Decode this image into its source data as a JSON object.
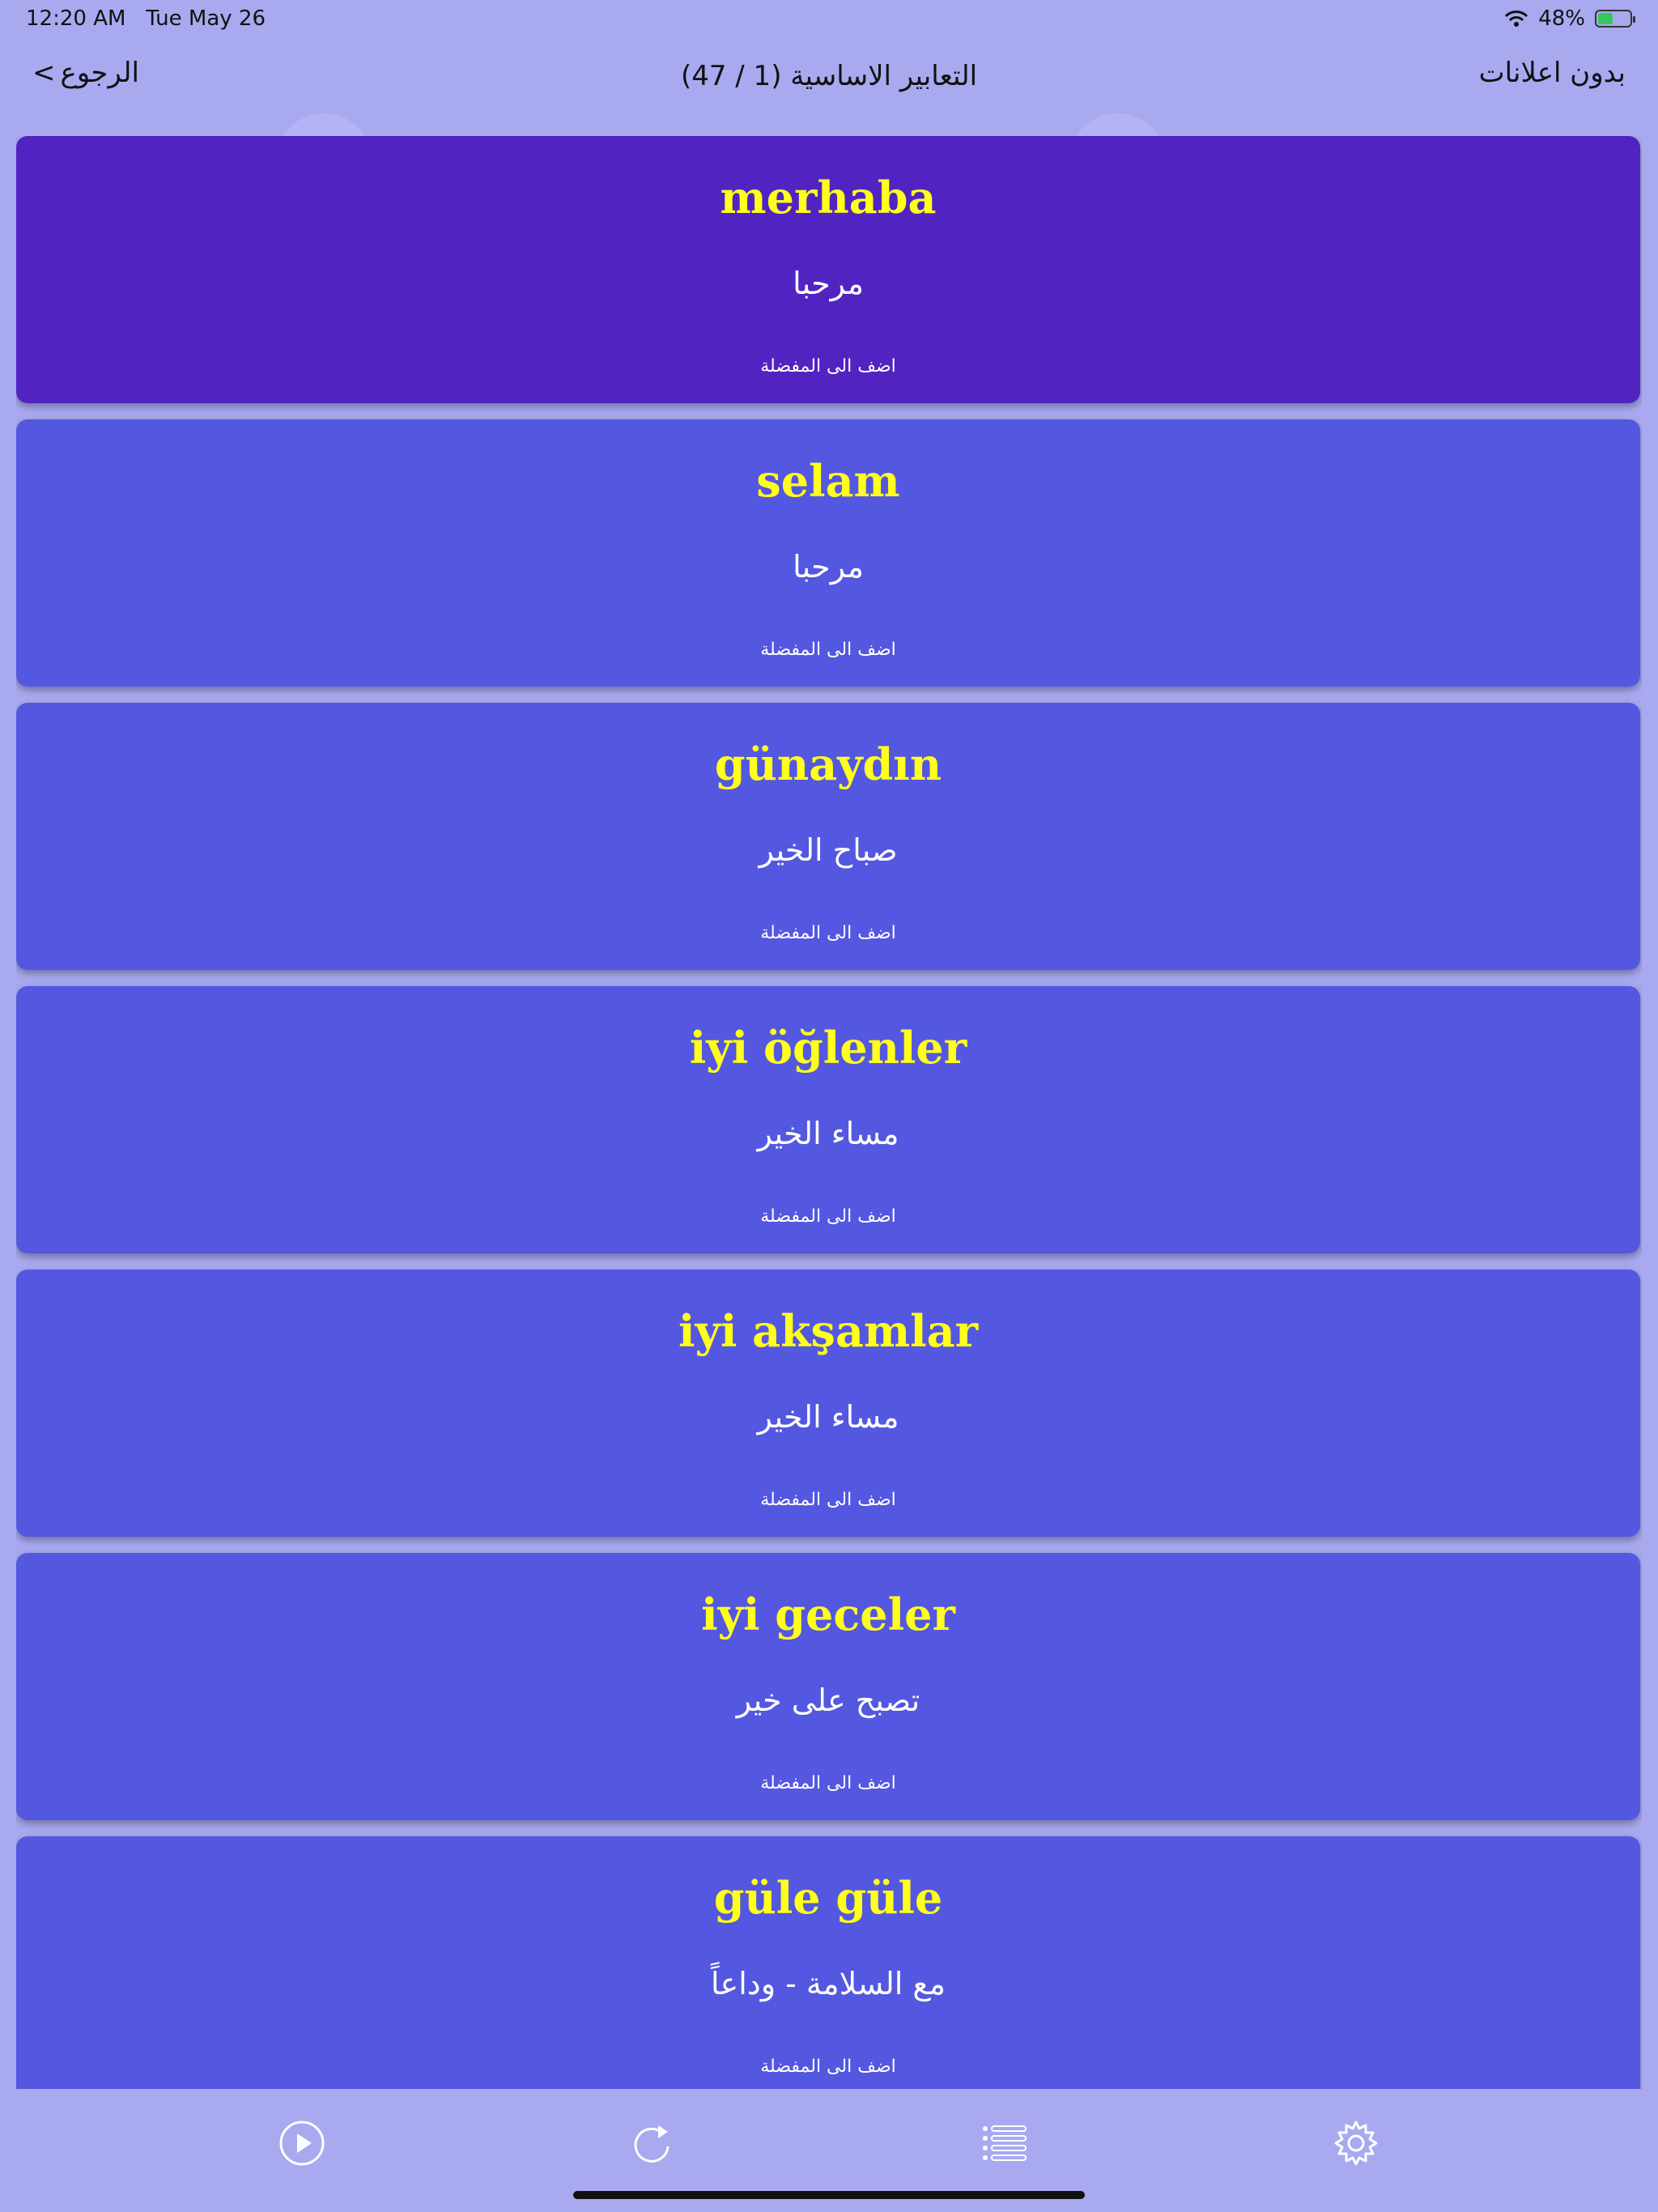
{
  "status_bar": {
    "time": "12:20 AM",
    "date": "Tue May 26",
    "battery": "48%",
    "battery_level": 0.48
  },
  "nav": {
    "back_label": "الرجوع",
    "back_chevron": "<",
    "title": "التعابير الاساسية  (1 / 47)",
    "right_label": "بدون اعلانات"
  },
  "cards": [
    {
      "term": "merhaba",
      "translation": "مرحبا",
      "favorite_label": "اضف الى المفضلة"
    },
    {
      "term": "selam",
      "translation": "مرحبا",
      "favorite_label": "اضف الى المفضلة"
    },
    {
      "term": "günaydın",
      "translation": "صباح الخير",
      "favorite_label": "اضف الى المفضلة"
    },
    {
      "term": "iyi öğlenler",
      "translation": "مساء الخير",
      "favorite_label": "اضف الى المفضلة"
    },
    {
      "term": "iyi akşamlar",
      "translation": "مساء الخير",
      "favorite_label": "اضف الى المفضلة"
    },
    {
      "term": "iyi geceler",
      "translation": "تصبح على خير",
      "favorite_label": "اضف الى المفضلة"
    },
    {
      "term": "güle güle",
      "translation": "مع السلامة - وداعاً",
      "favorite_label": "اضف الى المفضلة"
    }
  ],
  "tab_bar": {
    "icons": [
      "play-icon",
      "replay-icon",
      "list-icon",
      "settings-icon"
    ]
  },
  "colors": {
    "background": "#a9a9f0",
    "card": "#5457df",
    "card_active": "#5124c2",
    "term_text": "#ffff1a"
  }
}
